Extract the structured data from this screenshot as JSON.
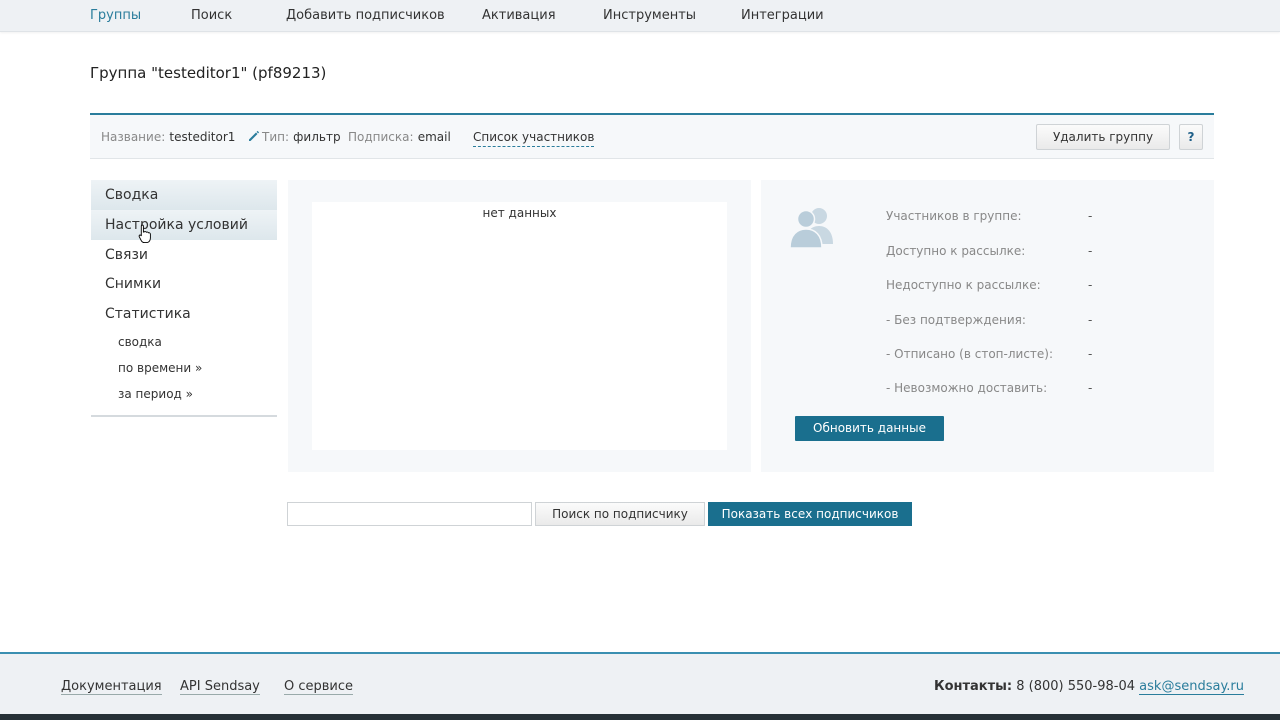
{
  "nav": {
    "items": [
      "Группы",
      "Поиск",
      "Добавить подписчиков",
      "Активация",
      "Инструменты",
      "Интеграции"
    ],
    "active_index": 0
  },
  "page": {
    "title": "Группа \"testeditor1\" (pf89213)"
  },
  "infobar": {
    "name_label": "Название:",
    "name_value": "testeditor1",
    "type_label": "Тип:",
    "type_value": "фильтр",
    "subscription_label": "Подписка:",
    "subscription_value": "email",
    "members_link": "Список участников",
    "delete_button": "Удалить группу",
    "help_button": "?"
  },
  "sidebar": {
    "items": [
      "Сводка",
      "Настройка условий",
      "Связи",
      "Снимки",
      "Статистика"
    ],
    "sub_items": [
      "сводка",
      "по времени »",
      "за период »"
    ]
  },
  "center": {
    "no_data": "нет данных"
  },
  "stats": {
    "rows": [
      {
        "label": "Участников в группе:",
        "value": "-"
      },
      {
        "label": "Доступно к рассылке:",
        "value": "-"
      },
      {
        "label": "Недоступно к рассылке:",
        "value": "-"
      },
      {
        "label": "- Без подтверждения:",
        "value": "-"
      },
      {
        "label": "- Отписано (в стоп-листе):",
        "value": "-"
      },
      {
        "label": "- Невозможно доставить:",
        "value": "-"
      }
    ],
    "refresh_button": "Обновить данные"
  },
  "search": {
    "input_value": "",
    "search_button": "Поиск по подписчику",
    "show_all_button": "Показать всех подписчиков"
  },
  "footer": {
    "links": [
      "Документация",
      "API Sendsay",
      "О сервисе"
    ],
    "contacts_label": "Контакты:",
    "phone": "8 (800) 550-98-04",
    "email": "ask@sendsay.ru"
  },
  "colors": {
    "accent": "#2a7d9c",
    "primary_button": "#1a6f8e",
    "panel_bg": "#f6f8fa"
  }
}
